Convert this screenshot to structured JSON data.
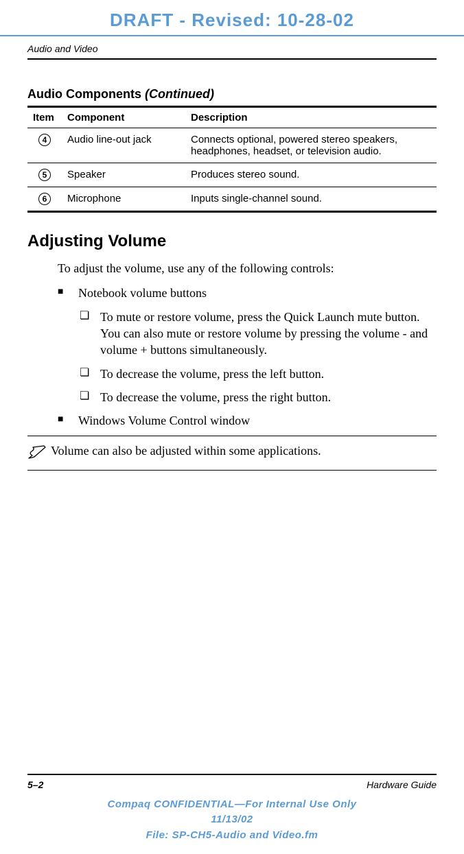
{
  "draft_banner": "DRAFT - Revised: 10-28-02",
  "chapter_title": "Audio and Video",
  "table": {
    "title": "Audio Components",
    "continued": "(Continued)",
    "headers": [
      "Item",
      "Component",
      "Description"
    ],
    "rows": [
      {
        "item": "4",
        "component": "Audio line-out jack",
        "description": "Connects optional, powered stereo speakers, headphones, headset, or television audio."
      },
      {
        "item": "5",
        "component": "Speaker",
        "description": "Produces stereo sound."
      },
      {
        "item": "6",
        "component": "Microphone",
        "description": "Inputs single-channel sound."
      }
    ]
  },
  "section": {
    "heading": "Adjusting Volume",
    "intro": "To adjust the volume, use any of the following controls:",
    "bullets": [
      {
        "text": "Notebook volume buttons",
        "subs": [
          "To mute or restore volume, press the Quick Launch mute button. You can also mute or restore volume by pressing the volume - and volume + buttons simultaneously.",
          "To decrease the volume, press the left button.",
          "To decrease the volume, press the right button."
        ]
      },
      {
        "text": "Windows Volume Control window",
        "subs": []
      }
    ],
    "note": "Volume can also be adjusted within some applications."
  },
  "footer": {
    "page": "5–2",
    "guide": "Hardware Guide",
    "confidential_line1": "Compaq CONFIDENTIAL—For Internal Use Only",
    "confidential_line2": "11/13/02",
    "confidential_line3": "File: SP-CH5-Audio and Video.fm"
  }
}
